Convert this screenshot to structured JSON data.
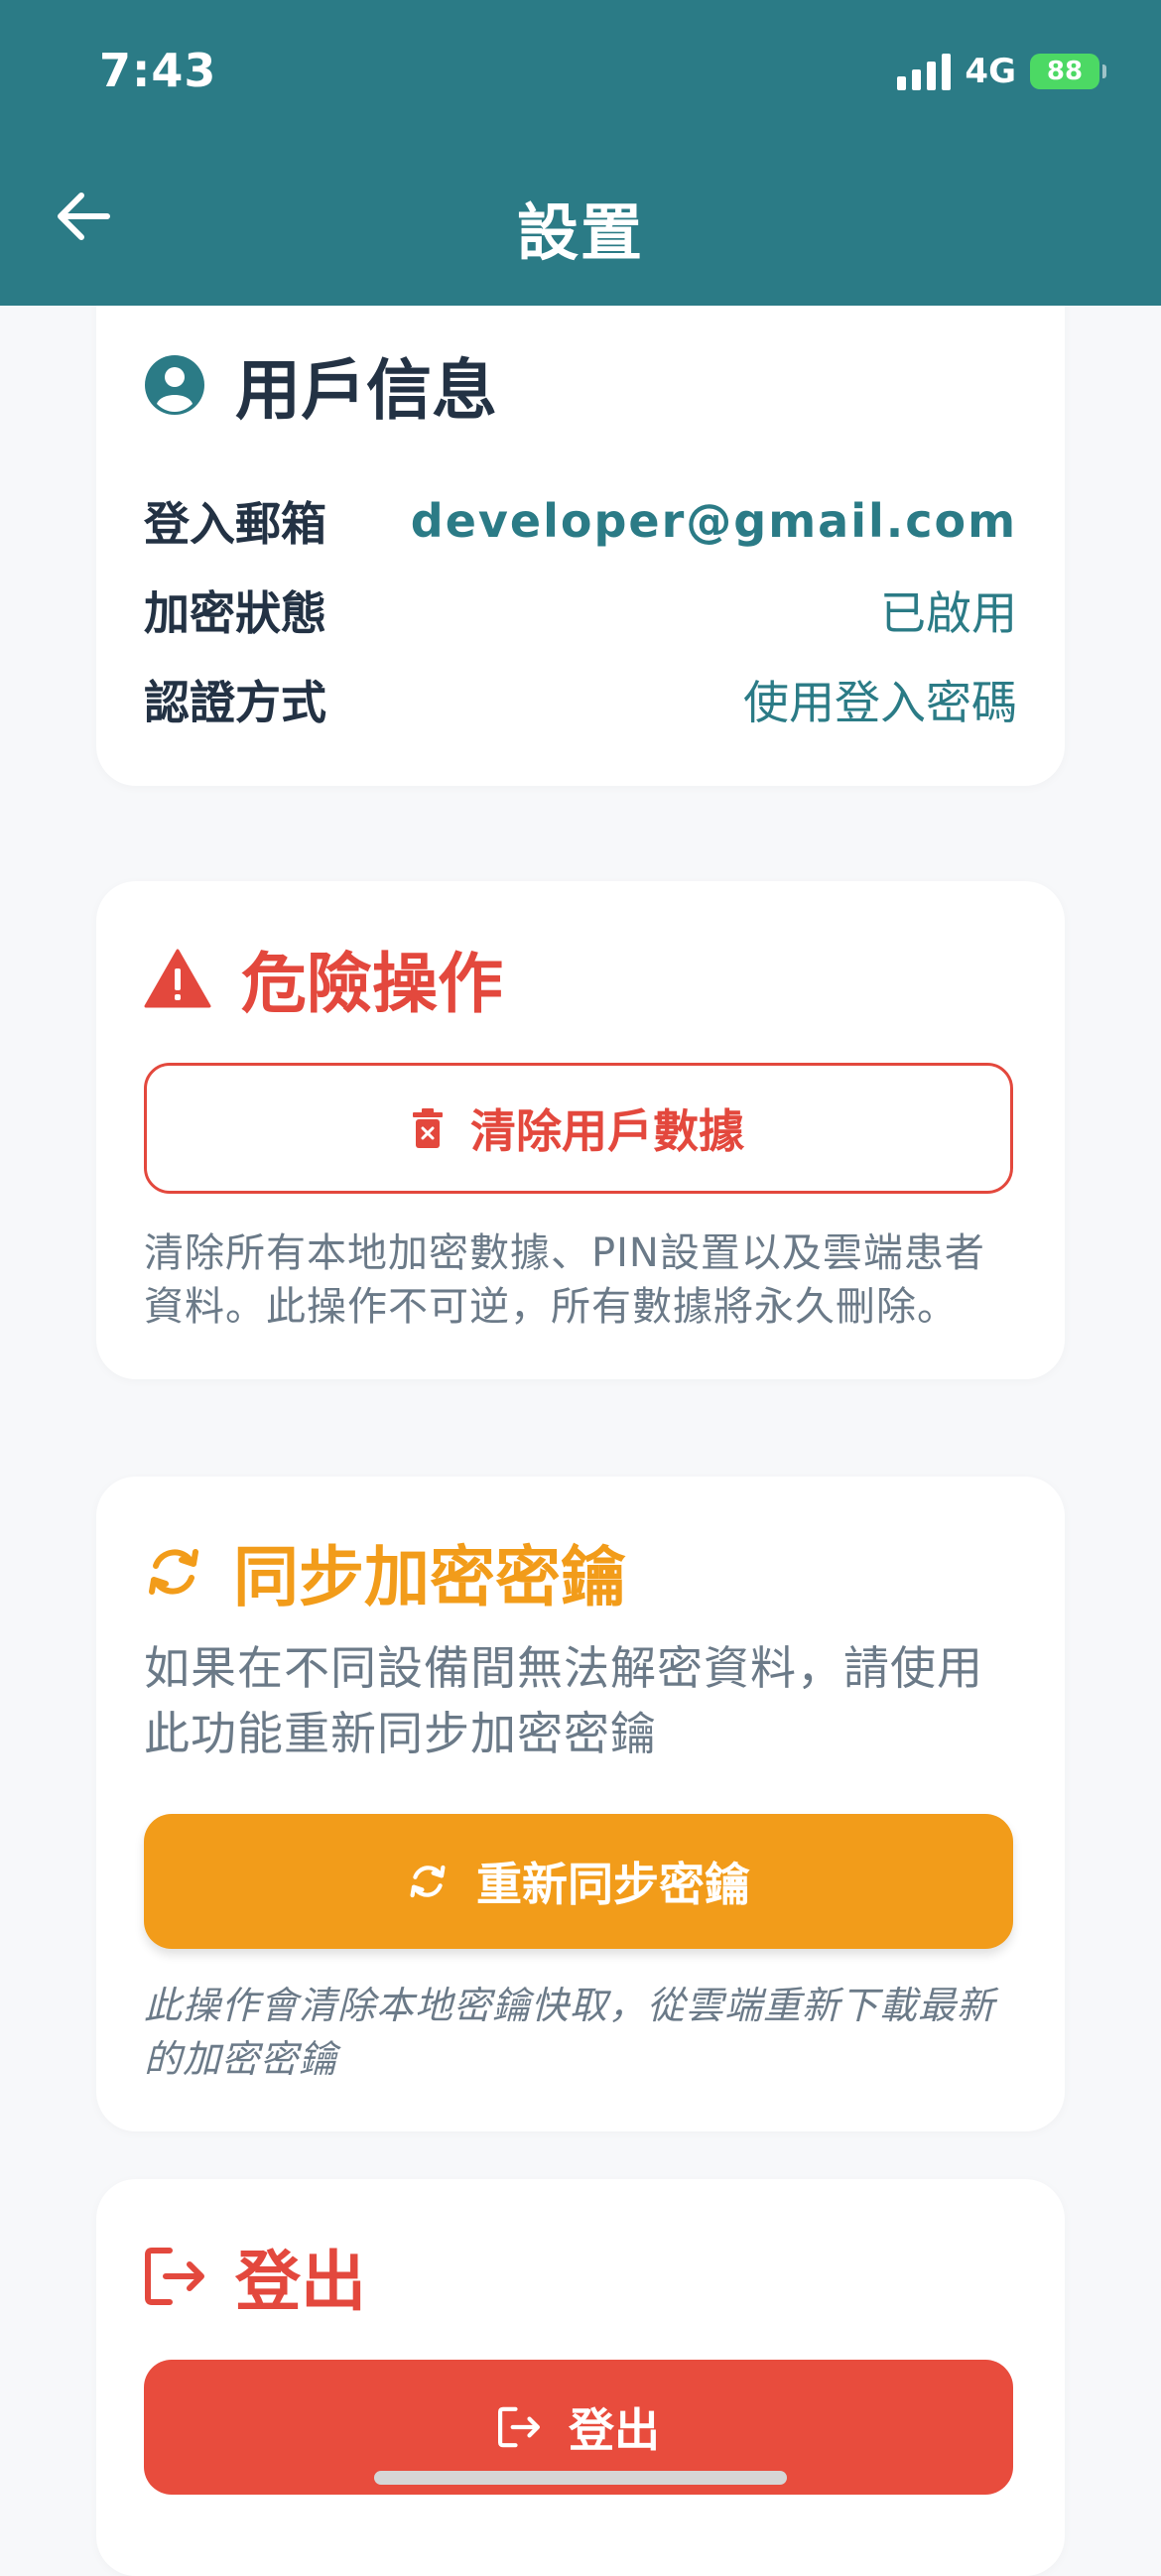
{
  "status_bar": {
    "time": "7:43",
    "network": "4G",
    "battery": "88"
  },
  "header": {
    "title": "設置"
  },
  "user_info": {
    "heading": "用戶信息",
    "rows": [
      {
        "label": "登入郵箱",
        "value": "developer@gmail.com"
      },
      {
        "label": "加密狀態",
        "value": "已啟用"
      },
      {
        "label": "認證方式",
        "value": "使用登入密碼"
      }
    ]
  },
  "danger": {
    "heading": "危險操作",
    "button_label": "清除用戶數據",
    "description": "清除所有本地加密數據、PIN設置以及雲端患者資料。此操作不可逆，所有數據將永久刪除。"
  },
  "sync": {
    "heading": "同步加密密鑰",
    "description": "如果在不同設備間無法解密資料，請使用此功能重新同步加密密鑰",
    "button_label": "重新同步密鑰",
    "note": "此操作會清除本地密鑰快取，從雲端重新下載最新的加密密鑰"
  },
  "logout": {
    "heading": "登出",
    "button_label": "登出"
  },
  "colors": {
    "header_bg": "#2b7b86",
    "danger": "#e3483d",
    "warning": "#f29c1a",
    "text_dark": "#233244",
    "text_muted": "#6b7a88"
  }
}
